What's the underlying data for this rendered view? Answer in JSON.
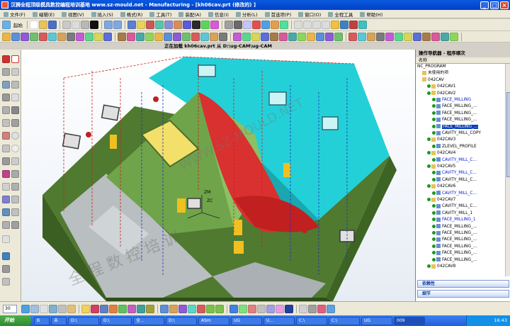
{
  "window": {
    "title": "汉狮全程顶级模具数控编程培训基地 www.sz-mould.net - Manufacturing - [kh06cav.prt  (修改的) ]",
    "min": "_",
    "max": "□",
    "close": "×"
  },
  "menu": [
    "文件(F)",
    "编辑(E)",
    "视图(V)",
    "插入(S)",
    "格式(R)",
    "工具(T)",
    "装配(A)",
    "信息(I)",
    "分析(L)",
    "首选项(P)",
    "窗口(O)",
    "全程工具",
    "帮助(H)"
  ],
  "toolbar": {
    "start_label": "起始",
    "toolbar2_icon_colors": [
      "#e8b74a",
      "#5b8fd6",
      "#8e5bd6",
      "#6fbf6f",
      "#d65b5b",
      "#5bc6d6",
      "#d6a35b",
      "#7a7a7a",
      "#c45bd6",
      "#5bd68e",
      "#d6d65b",
      "#5b6fd6",
      "#a87a4a",
      "#d65b9b",
      "#4aa8a8",
      "#8ed65b"
    ]
  },
  "status": {
    "loading_text": "正在加载 kh06cav.prt 从 D:\\ug-CAM\\ug-CAM"
  },
  "viewport": {
    "watermark_url": "WWW.SZ-MOULD.NET",
    "watermark_cn": "全 程 数 控 培 训",
    "axis_zm": "ZM",
    "axis_zc": "ZC"
  },
  "navigator": {
    "title": "操作导航器 - 程序顺次",
    "column": "名称",
    "rows": [
      {
        "text": "NC_PROGRAM",
        "indent": 0,
        "icon": "none",
        "style": "",
        "check": false
      },
      {
        "text": "未使用的项",
        "indent": 1,
        "icon": "folder",
        "style": "",
        "check": false
      },
      {
        "text": "042CAV",
        "indent": 1,
        "icon": "folder",
        "style": "",
        "check": false
      },
      {
        "text": "042CAV1",
        "indent": 2,
        "icon": "folder",
        "style": "",
        "check": true
      },
      {
        "text": "042CAV2",
        "indent": 2,
        "icon": "folder",
        "style": "",
        "check": true
      },
      {
        "text": "FACE_MILLING",
        "indent": 3,
        "icon": "op",
        "style": "blue",
        "check": true
      },
      {
        "text": "FACE_MILLING_...",
        "indent": 3,
        "icon": "op",
        "style": "",
        "check": true
      },
      {
        "text": "FACE_MILLING_...",
        "indent": 3,
        "icon": "op",
        "style": "",
        "check": true
      },
      {
        "text": "FACE_MILLING_...",
        "indent": 3,
        "icon": "op",
        "style": "",
        "check": true
      },
      {
        "text": "FACE_MILLING_...",
        "indent": 3,
        "icon": "op",
        "style": "sel",
        "check": true
      },
      {
        "text": "CAVITY_MILL_COPY",
        "indent": 3,
        "icon": "op",
        "style": "",
        "check": true
      },
      {
        "text": "042CAV3",
        "indent": 2,
        "icon": "folder",
        "style": "",
        "check": true
      },
      {
        "text": "ZLEVEL_PROFILE",
        "indent": 3,
        "icon": "op",
        "style": "",
        "check": true
      },
      {
        "text": "042CAV4",
        "indent": 2,
        "icon": "folder",
        "style": "",
        "check": true
      },
      {
        "text": "CAVITY_MILL_C...",
        "indent": 3,
        "icon": "op",
        "style": "blue",
        "check": true
      },
      {
        "text": "042CAV5",
        "indent": 2,
        "icon": "folder",
        "style": "",
        "check": true
      },
      {
        "text": "CAVITY_MILL_C...",
        "indent": 3,
        "icon": "op",
        "style": "blue",
        "check": true
      },
      {
        "text": "CAVITY_MILL_C...",
        "indent": 3,
        "icon": "op",
        "style": "",
        "check": true
      },
      {
        "text": "042CAV6",
        "indent": 2,
        "icon": "folder",
        "style": "",
        "check": true
      },
      {
        "text": "CAVITY_MILL_C...",
        "indent": 3,
        "icon": "op",
        "style": "blue",
        "check": true
      },
      {
        "text": "042CAV7",
        "indent": 2,
        "icon": "folder",
        "style": "",
        "check": true
      },
      {
        "text": "CAVITY_MILL_C...",
        "indent": 3,
        "icon": "op",
        "style": "",
        "check": true
      },
      {
        "text": "CAVITY_MILL_1",
        "indent": 3,
        "icon": "op",
        "style": "",
        "check": true
      },
      {
        "text": "FACE_MILLING_1",
        "indent": 3,
        "icon": "op",
        "style": "blue",
        "check": true
      },
      {
        "text": "FACE_MILLING_...",
        "indent": 3,
        "icon": "op",
        "style": "",
        "check": true
      },
      {
        "text": "FACE_MILLING_...",
        "indent": 3,
        "icon": "op",
        "style": "",
        "check": true
      },
      {
        "text": "FACE_MILLING_...",
        "indent": 3,
        "icon": "op",
        "style": "",
        "check": true
      },
      {
        "text": "FACE_MILLING_...",
        "indent": 3,
        "icon": "op",
        "style": "",
        "check": true
      },
      {
        "text": "FACE_MILLING_...",
        "indent": 3,
        "icon": "op",
        "style": "",
        "check": true
      },
      {
        "text": "FACE_MILLING_...",
        "indent": 3,
        "icon": "op",
        "style": "",
        "check": true
      },
      {
        "text": "042CAV8",
        "indent": 2,
        "icon": "folder",
        "style": "",
        "check": true
      }
    ],
    "panel_dependencies": "依赖性",
    "panel_details": "细节"
  },
  "bottom": {
    "zoom_value": "30"
  },
  "taskbar": {
    "start": "开始",
    "tasks": [
      "B",
      "未",
      "D:\\",
      "D:\\",
      "全...",
      "D:\\",
      "ASm",
      "UG",
      "U...",
      "C:\\",
      "C:\\",
      "UG",
      "009"
    ],
    "clock": "16:43"
  },
  "colors": {
    "selection": "#0a3fb8",
    "op_blue": "#0018c8",
    "check_green": "#1a9a1a"
  }
}
